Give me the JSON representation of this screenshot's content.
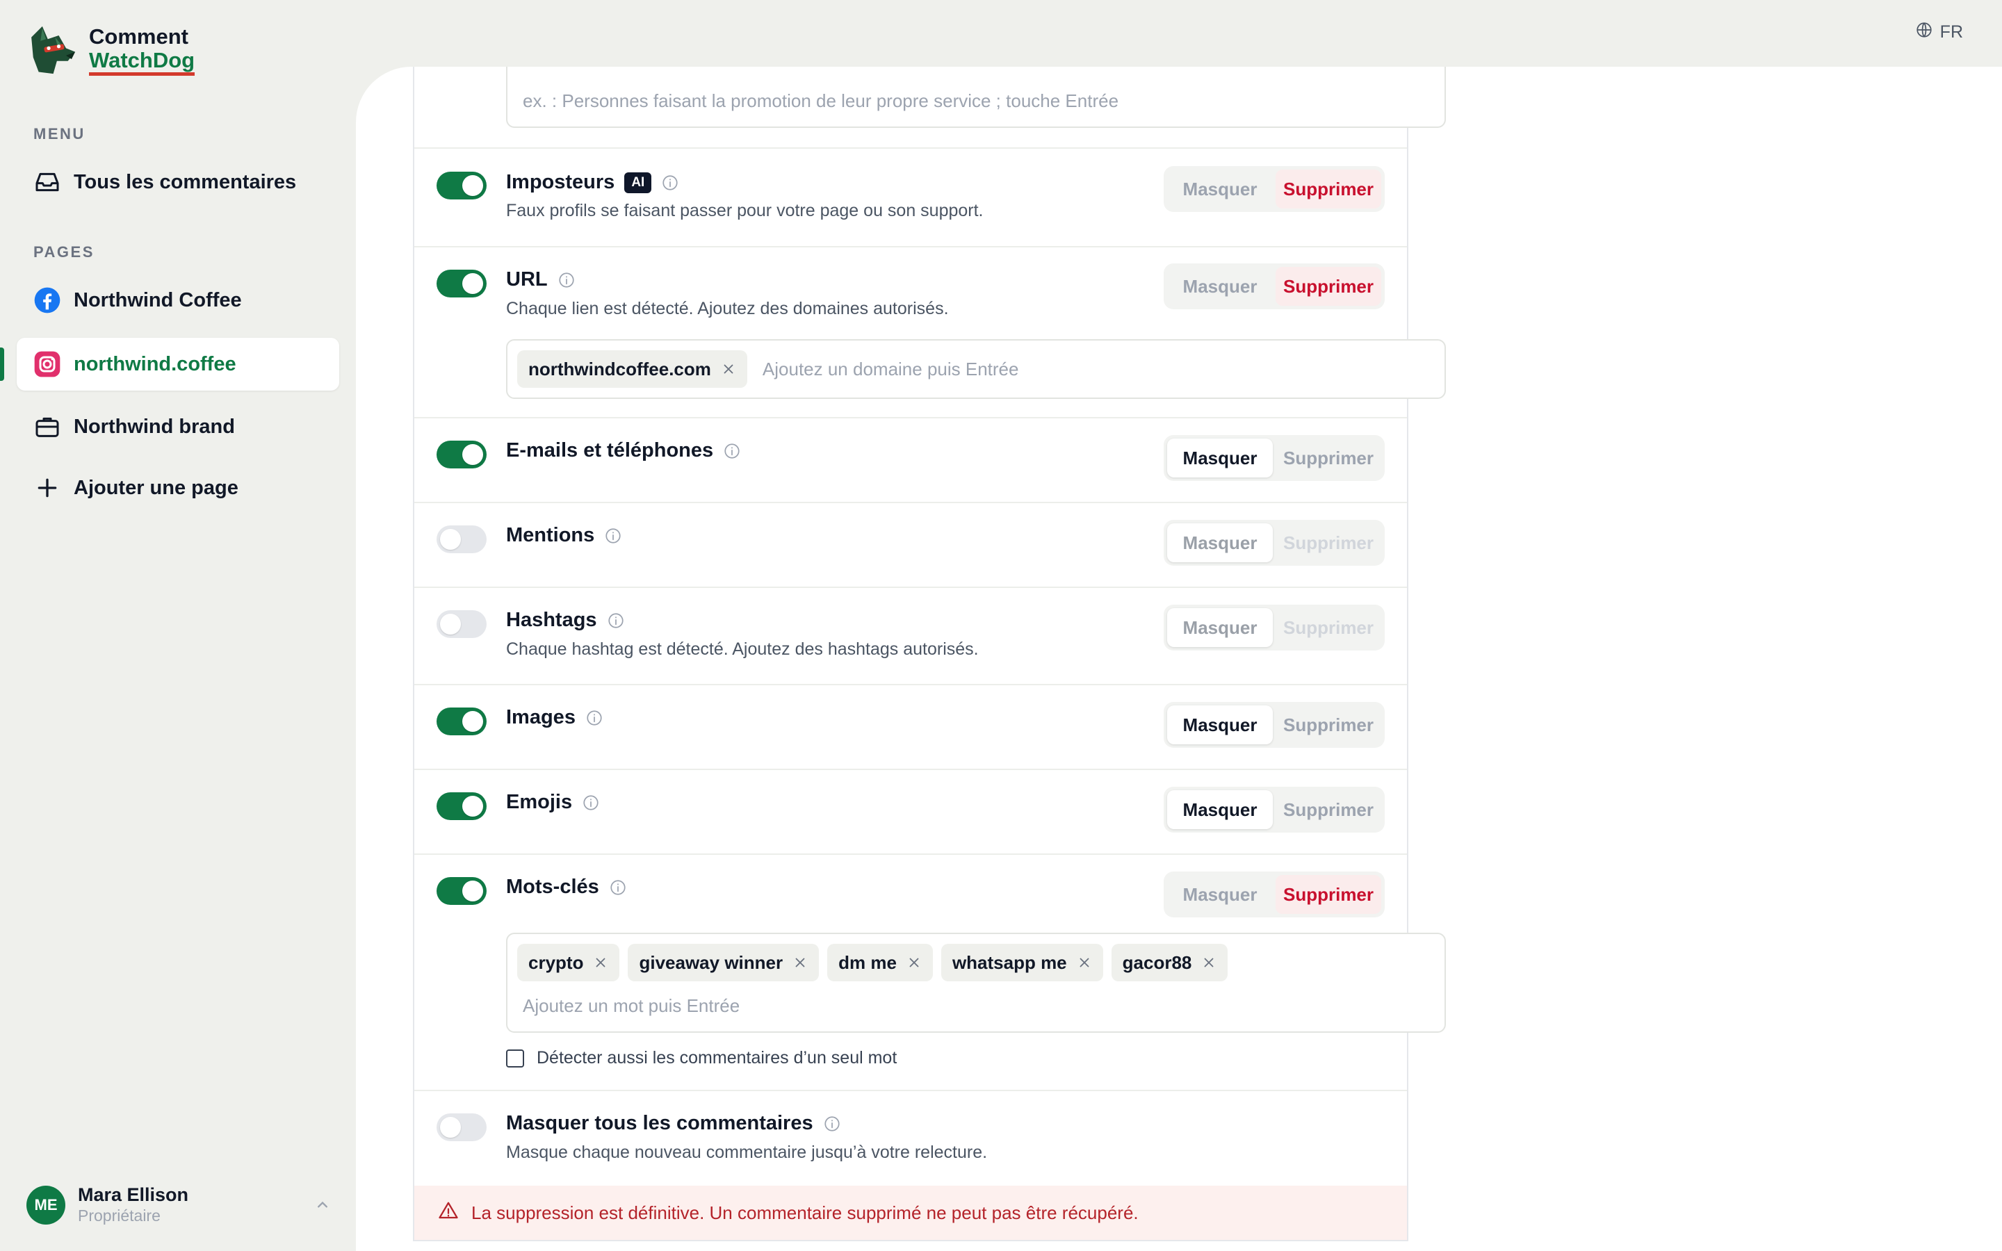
{
  "language": {
    "code": "FR"
  },
  "brand": {
    "line1": "Comment",
    "line2": "WatchDog"
  },
  "sidebar": {
    "menu_label": "MENU",
    "menu_items": [
      {
        "label": "Tous les commentaires",
        "icon": "inbox-icon"
      }
    ],
    "pages_label": "PAGES",
    "pages": [
      {
        "label": "Northwind Coffee",
        "icon": "facebook-icon"
      },
      {
        "label": "northwind.coffee",
        "icon": "instagram-icon",
        "active": true
      },
      {
        "label": "Northwind brand",
        "icon": "briefcase-icon"
      }
    ],
    "add_page": "Ajouter une page",
    "user": {
      "initials": "ME",
      "name": "Mara Ellison",
      "role": "Propriétaire"
    }
  },
  "rules": {
    "top_input_placeholder": "ex. : Personnes faisant la promotion de leur propre service ; touche Entrée",
    "hide_label": "Masquer",
    "delete_label": "Supprimer",
    "impostors": {
      "title": "Imposteurs",
      "badge": "AI",
      "desc": "Faux profils se faisant passer pour votre page ou son support.",
      "enabled": true,
      "action": "Supprimer"
    },
    "url": {
      "title": "URL",
      "desc": "Chaque lien est détecté. Ajoutez des domaines autorisés.",
      "enabled": true,
      "action": "Supprimer",
      "chips": [
        "northwindcoffee.com"
      ],
      "placeholder": "Ajoutez un domaine puis Entrée"
    },
    "emails": {
      "title": "E-mails et téléphones",
      "enabled": true,
      "action": "Masquer"
    },
    "mentions": {
      "title": "Mentions",
      "enabled": false,
      "action": "Masquer"
    },
    "hashtags": {
      "title": "Hashtags",
      "desc": "Chaque hashtag est détecté. Ajoutez des hashtags autorisés.",
      "enabled": false,
      "action": "Masquer"
    },
    "images": {
      "title": "Images",
      "enabled": true,
      "action": "Masquer"
    },
    "emojis": {
      "title": "Emojis",
      "enabled": true,
      "action": "Masquer"
    },
    "keywords": {
      "title": "Mots-clés",
      "enabled": true,
      "action": "Supprimer",
      "chips": [
        "crypto",
        "giveaway winner",
        "dm me",
        "whatsapp me",
        "gacor88"
      ],
      "placeholder": "Ajoutez un mot puis Entrée",
      "single_word_checkbox": "Détecter aussi les commentaires d’un seul mot",
      "single_word_checked": false
    },
    "hide_all": {
      "title": "Masquer tous les commentaires",
      "desc": "Masque chaque nouveau commentaire jusqu’à votre relecture.",
      "enabled": false
    }
  },
  "warning": "La suppression est définitive. Un commentaire supprimé ne peut pas être récupéré.",
  "colors": {
    "brand_green": "#0f7a45",
    "danger_red": "#c8102e",
    "sidebar_bg": "#eff0ec"
  }
}
